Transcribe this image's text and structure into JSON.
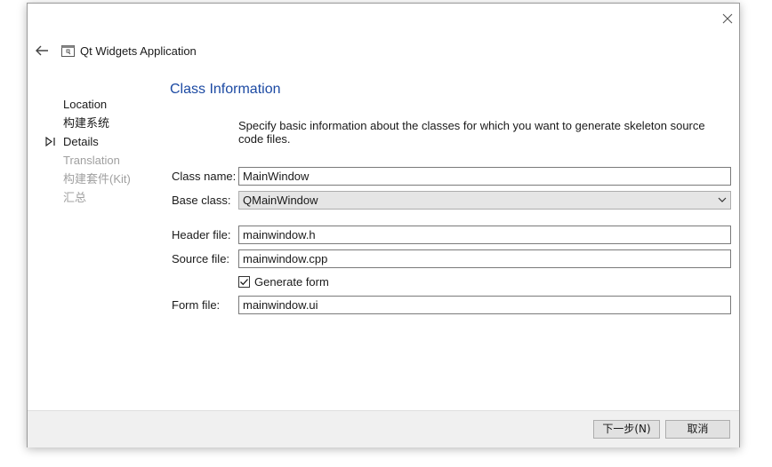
{
  "window": {
    "title": "Qt Widgets Application",
    "icons": {
      "back": "arrow-left-icon",
      "close": "close-icon",
      "app": "qt-project-icon"
    }
  },
  "steps": [
    {
      "label": "Location",
      "state": "done"
    },
    {
      "label": "构建系统",
      "state": "done"
    },
    {
      "label": "Details",
      "state": "current"
    },
    {
      "label": "Translation",
      "state": "pending"
    },
    {
      "label": "构建套件(Kit)",
      "state": "pending"
    },
    {
      "label": "汇总",
      "state": "pending"
    }
  ],
  "page": {
    "title": "Class Information",
    "description": "Specify basic information about the classes for which you want to generate skeleton source code files."
  },
  "form": {
    "class_name": {
      "label": "Class name:",
      "value": "MainWindow"
    },
    "base_class": {
      "label": "Base class:",
      "value": "QMainWindow"
    },
    "header_file": {
      "label": "Header file:",
      "value": "mainwindow.h"
    },
    "source_file": {
      "label": "Source file:",
      "value": "mainwindow.cpp"
    },
    "generate_form": {
      "label": "Generate form",
      "checked": true
    },
    "form_file": {
      "label": "Form file:",
      "value": "mainwindow.ui"
    }
  },
  "buttons": {
    "next": "下一步(N)",
    "cancel": "取消"
  },
  "colors": {
    "accent": "#1c4aa3",
    "footer_bg": "#f0f0f0",
    "pending_text": "#a0a0a0"
  }
}
